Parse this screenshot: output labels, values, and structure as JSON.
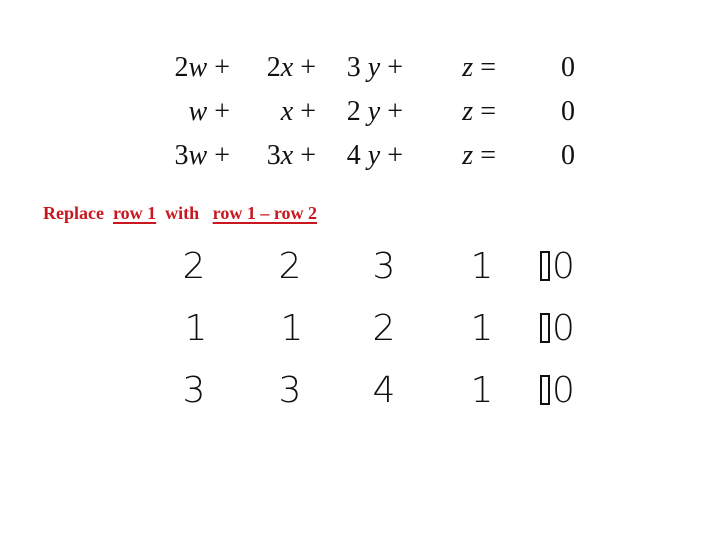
{
  "equations": [
    {
      "terms": [
        "2w +",
        "2x +",
        "3y +",
        "z =",
        "0"
      ],
      "coef": [
        "2",
        "2",
        "3",
        ""
      ],
      "vars": [
        "w",
        "x",
        "y",
        "z"
      ],
      "rhs": "0"
    },
    {
      "terms": [
        "w +",
        "x +",
        "2y +",
        "z =",
        "0"
      ],
      "coef": [
        "",
        "",
        "2",
        ""
      ],
      "vars": [
        "w",
        "x",
        "y",
        "z"
      ],
      "rhs": "0"
    },
    {
      "terms": [
        "3w +",
        "3x +",
        "4y +",
        "z =",
        "0"
      ],
      "coef": [
        "3",
        "3",
        "4",
        ""
      ],
      "vars": [
        "w",
        "x",
        "y",
        "z"
      ],
      "rhs": "0"
    }
  ],
  "instruction": {
    "prefix": "Replace",
    "target": "row 1",
    "middle": "with",
    "operation": "row 1 – row 2",
    "color": "#c8171e"
  },
  "matrix": {
    "rows": [
      [
        "2",
        "2",
        "3",
        "1",
        "0"
      ],
      [
        "1",
        "1",
        "2",
        "1",
        "0"
      ],
      [
        "3",
        "3",
        "4",
        "1",
        "0"
      ]
    ],
    "separator_glyph": "missing-glyph-box"
  }
}
